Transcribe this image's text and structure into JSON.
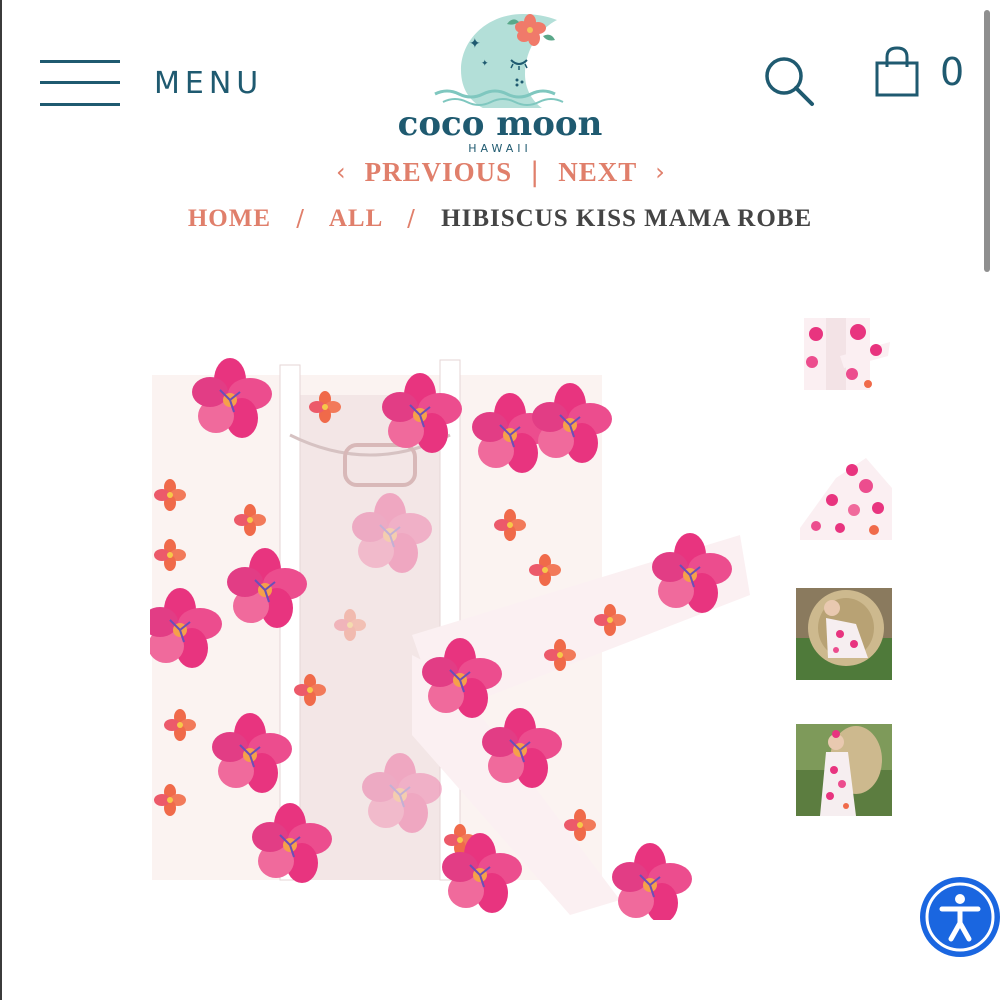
{
  "header": {
    "menu_label": "MENU",
    "logo_text": "coco moon",
    "logo_subtext": "HAWAII",
    "cart_count": "0",
    "icons": [
      "menu-icon",
      "search-icon",
      "shopping-bag-icon"
    ]
  },
  "pager": {
    "previous_label": "PREVIOUS",
    "separator": "|",
    "next_label": "NEXT"
  },
  "breadcrumb": {
    "items": [
      {
        "label": "HOME"
      },
      {
        "label": "ALL"
      },
      {
        "label": "HIBISCUS KISS MAMA ROBE"
      }
    ],
    "separator": "/"
  },
  "colors": {
    "brand_teal": "#1f5a70",
    "accent_coral": "#e07f6b",
    "text_dark": "#444444",
    "accessibility_blue": "#1a66e0",
    "hibiscus_pink": "#e8347f"
  },
  "gallery": {
    "thumbnail_count": 4
  }
}
